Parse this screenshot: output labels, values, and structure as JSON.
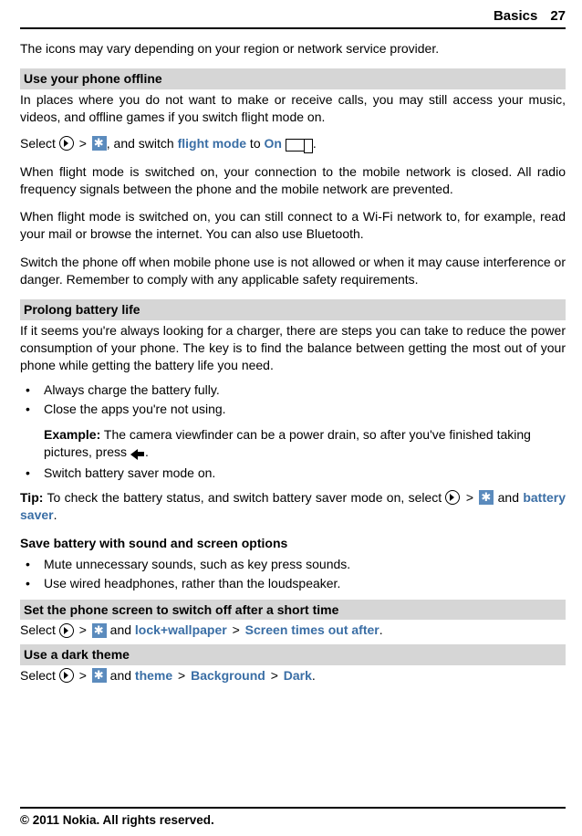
{
  "header": {
    "chapter": "Basics",
    "page": "27"
  },
  "p_intro": "The icons may vary depending on your region or network service provider.",
  "sec_offline": {
    "heading": "Use your phone offline",
    "p1": "In places where you do not want to make or receive calls, you may still access your music, videos, and offline games if you switch flight mode on.",
    "select_word": "Select",
    "gt": ">",
    "switch_text": ", and switch ",
    "flight_mode": "flight mode",
    "to_word": " to ",
    "on_word": "On",
    "period": ".",
    "p2": "When flight mode is switched on, your connection to the mobile network is closed. All radio frequency signals between the phone and the mobile network are prevented.",
    "p3": "When flight mode is switched on, you can still connect to a Wi-Fi network to, for example, read your mail or browse the internet. You can also use Bluetooth.",
    "p4": "Switch the phone off when mobile phone use is not allowed or when it may cause interference or danger. Remember to comply with any applicable safety requirements."
  },
  "sec_battery": {
    "heading": "Prolong battery life",
    "p1": "If it seems you're always looking for a charger, there are steps you can take to reduce the power consumption of your phone. The key is to find the balance between getting the most out of your phone while getting the battery life you need.",
    "b1": "Always charge the battery fully.",
    "b2": "Close the apps you're not using.",
    "example_label": "Example:",
    "example_text": " The camera viewfinder can be a power drain, so after you've finished taking pictures, press ",
    "b3": "Switch battery saver mode on.",
    "tip_label": "Tip:",
    "tip_text1": " To check the battery status, and switch battery saver mode on, select ",
    "tip_and": " and ",
    "battery_saver": "battery saver"
  },
  "sec_sound": {
    "heading": "Save battery with sound and screen options",
    "b1": "Mute unnecessary sounds, such as key press sounds.",
    "b2": "Use wired headphones, rather than the loudspeaker."
  },
  "sec_screen": {
    "heading": "Set the phone screen to switch off after a short time",
    "select_word": "Select ",
    "gt": ">",
    "and_word": " and ",
    "lock_wallpaper": "lock+wallpaper",
    "screen_times": "Screen times out after"
  },
  "sec_theme": {
    "heading": "Use a dark theme",
    "select_word": "Select ",
    "gt": ">",
    "and_word": " and ",
    "theme": "theme",
    "background": "Background",
    "dark": "Dark"
  },
  "footer": "© 2011 Nokia. All rights reserved."
}
